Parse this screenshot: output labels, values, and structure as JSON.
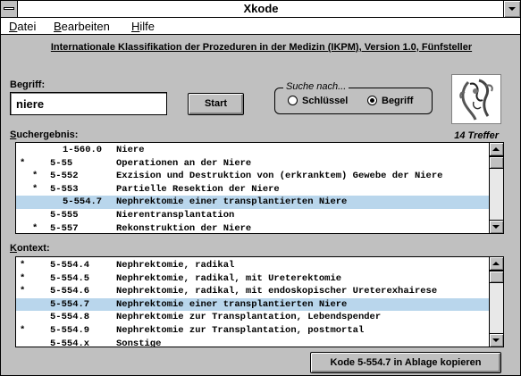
{
  "window": {
    "title": "Xkode"
  },
  "menu": {
    "items": [
      {
        "underlined": "D",
        "rest": "atei"
      },
      {
        "underlined": "B",
        "rest": "earbeiten"
      },
      {
        "underlined": "H",
        "rest": "ilfe"
      }
    ]
  },
  "heading": "Internationale Klassifikation der Prozeduren in der Medizin (IKPM), Version 1.0, Fünfsteller",
  "search": {
    "label": "Begriff:",
    "value": "niere",
    "start_label": "Start"
  },
  "mode": {
    "title": "Suche nach...",
    "options": [
      {
        "label": "Schlüssel",
        "checked": false
      },
      {
        "label": "Begriff",
        "checked": true
      }
    ]
  },
  "logo": {
    "icon": "kidney-illustration-icon"
  },
  "results": {
    "label_underlined": "S",
    "label_rest": "uchergebnis:",
    "count_text": "14 Treffer",
    "rows": [
      {
        "mark": "",
        "code": "1-560.0",
        "desc": "Niere",
        "indent": 0,
        "selected": false
      },
      {
        "mark": "*",
        "code": "5-55",
        "desc": "Operationen an der Niere",
        "indent": 1,
        "selected": false
      },
      {
        "mark": "*",
        "code": "5-552",
        "desc": "Exzision und Destruktion von (erkranktem) Gewebe der Niere",
        "indent": 2,
        "selected": false
      },
      {
        "mark": "*",
        "code": "5-553",
        "desc": "Partielle Resektion der Niere",
        "indent": 2,
        "selected": false
      },
      {
        "mark": "",
        "code": "5-554.7",
        "desc": "Nephrektomie einer transplantierten Niere",
        "indent": 3,
        "selected": true
      },
      {
        "mark": "",
        "code": "5-555",
        "desc": "Nierentransplantation",
        "indent": 2,
        "selected": false
      },
      {
        "mark": "*",
        "code": "5-557",
        "desc": "Rekonstruktion der Niere",
        "indent": 2,
        "selected": false
      }
    ],
    "scroll_fraction": 0.0
  },
  "context": {
    "label_underlined": "K",
    "label_rest": "ontext:",
    "rows": [
      {
        "mark": "*",
        "code": "5-554.4",
        "desc": "Nephrektomie, radikal",
        "selected": false
      },
      {
        "mark": "*",
        "code": "5-554.5",
        "desc": "Nephrektomie, radikal, mit Ureterektomie",
        "selected": false
      },
      {
        "mark": "*",
        "code": "5-554.6",
        "desc": "Nephrektomie, radikal, mit endoskopischer Ureterexhairese",
        "selected": false
      },
      {
        "mark": "",
        "code": "5-554.7",
        "desc": "Nephrektomie einer transplantierten Niere",
        "selected": true
      },
      {
        "mark": "",
        "code": "5-554.8",
        "desc": "Nephrektomie zur Transplantation, Lebendspender",
        "selected": false
      },
      {
        "mark": "*",
        "code": "5-554.9",
        "desc": "Nephrektomie zur Transplantation, postmortal",
        "selected": false
      },
      {
        "mark": "",
        "code": "5-554.x",
        "desc": "Sonstige",
        "selected": false
      }
    ],
    "scroll_fraction": 0.0
  },
  "copy_button_label": "Kode 5-554.7 in Ablage kopieren",
  "colors": {
    "selection": "#b9d6ec",
    "face": "#c0c0c0"
  }
}
